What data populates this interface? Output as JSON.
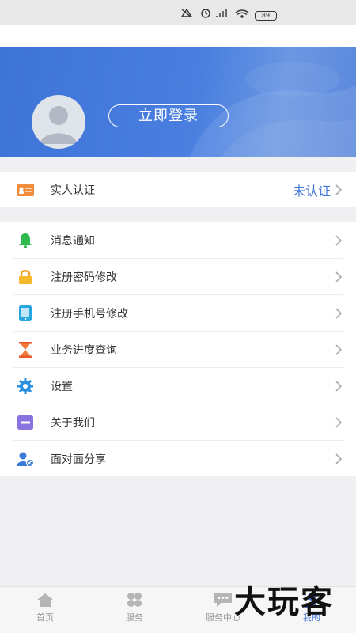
{
  "status_bar": {
    "battery": "89"
  },
  "header": {
    "login_label": "立即登录"
  },
  "verify": {
    "label": "实人认证",
    "status": "未认证"
  },
  "menu": [
    {
      "label": "消息通知",
      "icon": "bell-icon"
    },
    {
      "label": "注册密码修改",
      "icon": "lock-icon"
    },
    {
      "label": "注册手机号修改",
      "icon": "phone-icon"
    },
    {
      "label": "业务进度查询",
      "icon": "hourglass-icon"
    },
    {
      "label": "设置",
      "icon": "gear-icon"
    },
    {
      "label": "关于我们",
      "icon": "minus-square-icon"
    },
    {
      "label": "面对面分享",
      "icon": "share-user-icon"
    }
  ],
  "tabs": [
    {
      "label": "首页",
      "icon": "home-icon"
    },
    {
      "label": "服务",
      "icon": "grid-icon"
    },
    {
      "label": "服务中心",
      "icon": "chat-icon"
    },
    {
      "label": "我的",
      "icon": "user-icon",
      "active": true
    }
  ],
  "watermark": "大玩客",
  "colors": {
    "primary": "#3e73d8",
    "background": "#f0f0f2"
  }
}
